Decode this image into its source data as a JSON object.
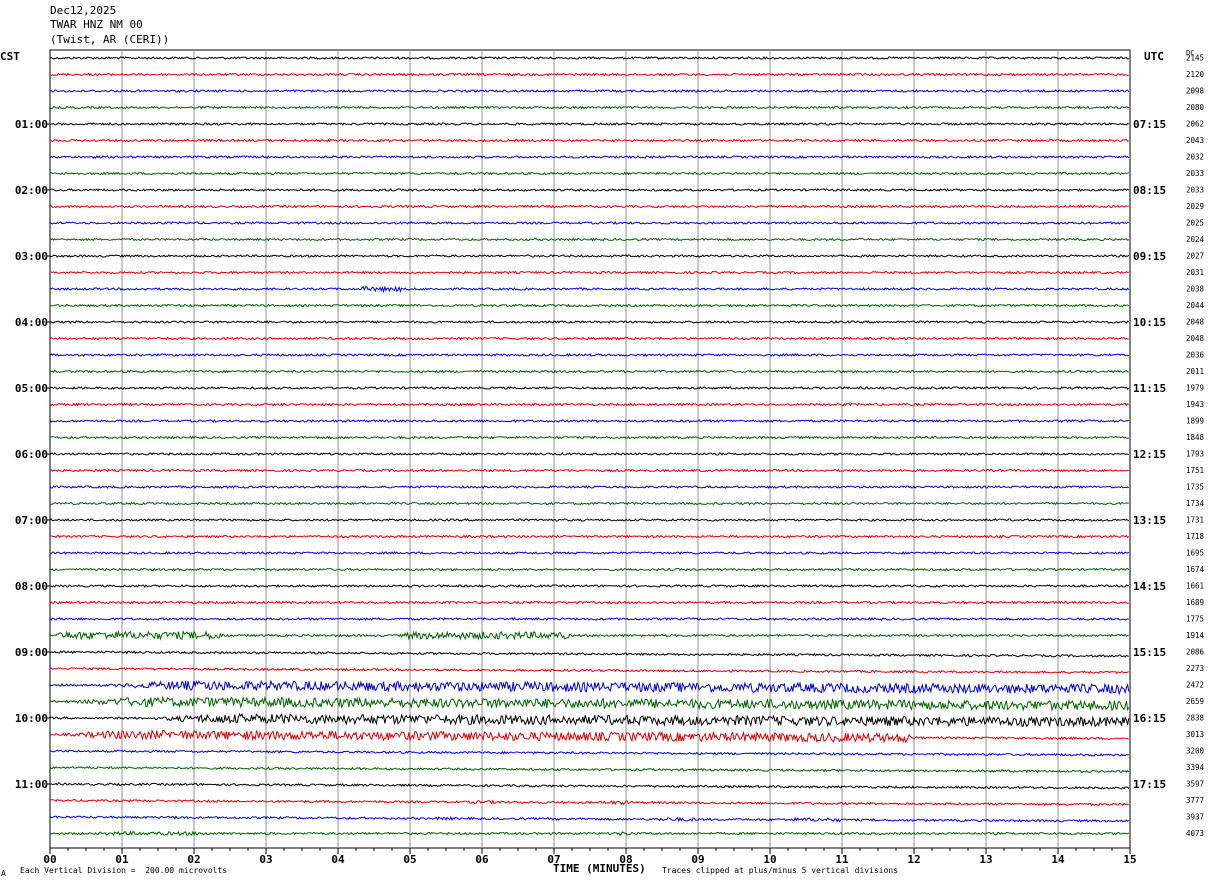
{
  "header": {
    "date": "Dec12,2025",
    "station": "TWAR HNZ NM 00",
    "location": "(Twist, AR (CERI))"
  },
  "left_label": "CST",
  "right_label": "UTC",
  "dc_label": "DC",
  "footer": {
    "left": "Each Vertical Division =  200.00 microvolts",
    "center": "TIME (MINUTES)",
    "right": "Traces clipped at plus/minus 5 vertical divisions",
    "mark": "A"
  },
  "chart_data": {
    "type": "line",
    "xlabel": "TIME (MINUTES)",
    "xlim": [
      0,
      15
    ],
    "x_ticks": [
      "00",
      "01",
      "02",
      "03",
      "04",
      "05",
      "06",
      "07",
      "08",
      "09",
      "10",
      "11",
      "12",
      "13",
      "14",
      "15"
    ],
    "trace_colors": [
      "#000000",
      "#e00000",
      "#0000e0",
      "#006400"
    ],
    "cst_labels": [
      "01:00",
      "02:00",
      "03:00",
      "04:00",
      "05:00",
      "06:00",
      "07:00",
      "08:00",
      "09:00",
      "10:00",
      "11:00"
    ],
    "utc_labels": [
      "07:15",
      "08:15",
      "09:15",
      "10:15",
      "11:15",
      "12:15",
      "13:15",
      "14:15",
      "15:15",
      "16:15",
      "17:15"
    ],
    "dc_values": [
      "2145",
      "2120",
      "2098",
      "2080",
      "2062",
      "2043",
      "2032",
      "2033",
      "2033",
      "2029",
      "2025",
      "2024",
      "2027",
      "2031",
      "2038",
      "2044",
      "2048",
      "2048",
      "2036",
      "2011",
      "1979",
      "1943",
      "1899",
      "1848",
      "1793",
      "1751",
      "1735",
      "1734",
      "1731",
      "1718",
      "1695",
      "1674",
      "1661",
      "1689",
      "1775",
      "1914",
      "2086",
      "2273",
      "2472",
      "2659",
      "2838",
      "3013",
      "3200",
      "3394",
      "3597",
      "3777",
      "3937",
      "4073"
    ],
    "trace_activity": [
      {
        "trace": 14,
        "start_min": 4.3,
        "end_min": 4.9,
        "amplitude": 0.8
      },
      {
        "trace": 35,
        "start_min": 0.0,
        "end_min": 2.4,
        "amplitude": 1.3
      },
      {
        "trace": 35,
        "start_min": 4.8,
        "end_min": 7.2,
        "amplitude": 1.2
      },
      {
        "trace": 37,
        "start_min": 11.3,
        "end_min": 11.9,
        "amplitude": 0.4
      },
      {
        "trace": 38,
        "start_min": 0.6,
        "end_min": 15.0,
        "amplitude": 1.6
      },
      {
        "trace": 39,
        "start_min": 0.0,
        "end_min": 15.0,
        "amplitude": 1.6
      },
      {
        "trace": 40,
        "start_min": 1.2,
        "end_min": 15.0,
        "amplitude": 1.6
      },
      {
        "trace": 41,
        "start_min": 0.0,
        "end_min": 12.0,
        "amplitude": 1.5
      },
      {
        "trace": 43,
        "start_min": 13.0,
        "end_min": 13.8,
        "amplitude": 0.4
      },
      {
        "trace": 44,
        "start_min": 6.0,
        "end_min": 6.5,
        "amplitude": 0.3
      },
      {
        "trace": 45,
        "start_min": 5.8,
        "end_min": 6.3,
        "amplitude": 0.5
      },
      {
        "trace": 45,
        "start_min": 7.6,
        "end_min": 8.1,
        "amplitude": 0.6
      },
      {
        "trace": 46,
        "start_min": 8.4,
        "end_min": 9.0,
        "amplitude": 0.6
      },
      {
        "trace": 46,
        "start_min": 10.2,
        "end_min": 11.0,
        "amplitude": 0.6
      },
      {
        "trace": 46,
        "start_min": 1.6,
        "end_min": 1.9,
        "amplitude": 0.5
      },
      {
        "trace": 46,
        "start_min": 5.3,
        "end_min": 5.6,
        "amplitude": 0.5
      },
      {
        "trace": 47,
        "start_min": 0.6,
        "end_min": 2.2,
        "amplitude": 0.6
      },
      {
        "trace": 47,
        "start_min": 7.8,
        "end_min": 8.1,
        "amplitude": 0.6
      }
    ]
  }
}
